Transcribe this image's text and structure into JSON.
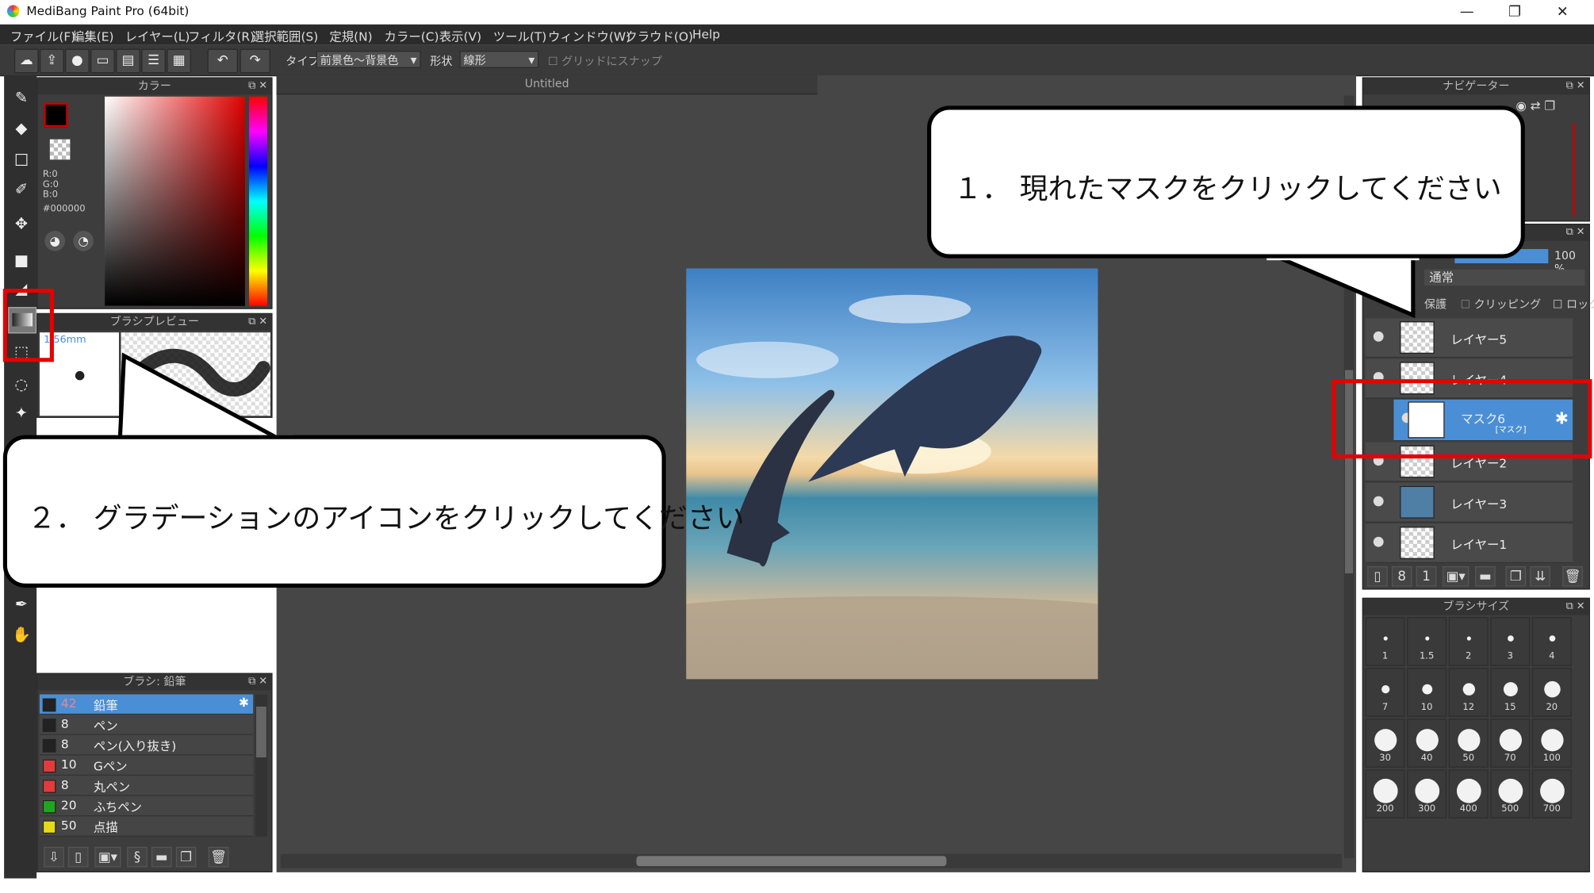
{
  "window": {
    "title": "MediBang Paint Pro (64bit)",
    "minimize": "—",
    "restore": "❐",
    "close": "✕"
  },
  "menu": [
    "ファイル(F)",
    "編集(E)",
    "レイヤー(L)",
    "フィルタ(R)",
    "選択範囲(S)",
    "定規(N)",
    "カラー(C)",
    "表示(V)",
    "ツール(T)",
    "ウィンドウ(W)",
    "クラウド(O)",
    "Help"
  ],
  "toolbar": {
    "type_label": "タイプ",
    "type_value": "前景色〜背景色",
    "shape_label": "形状",
    "shape_value": "線形",
    "grid_snap": "グリッドにスナップ"
  },
  "color_panel": {
    "title": "カラー",
    "r": "R:0",
    "g": "G:0",
    "b": "B:0",
    "hex": "#000000"
  },
  "brush_preview": {
    "title": "ブラシプレビュー",
    "size": "1.56mm"
  },
  "brush_panel": {
    "title": "ブラシ: 鉛筆",
    "items": [
      {
        "size": "42",
        "name": "鉛筆",
        "color": "#222222"
      },
      {
        "size": "8",
        "name": "ペン",
        "color": "#222222"
      },
      {
        "size": "8",
        "name": "ペン(入り抜き)",
        "color": "#222222"
      },
      {
        "size": "10",
        "name": "Gペン",
        "color": "#e23b3b"
      },
      {
        "size": "8",
        "name": "丸ペン",
        "color": "#e23b3b"
      },
      {
        "size": "20",
        "name": "ふちペン",
        "color": "#1fa51f"
      },
      {
        "size": "50",
        "name": "点描",
        "color": "#e8d81a"
      }
    ]
  },
  "canvas": {
    "tab": "Untitled"
  },
  "navigator": {
    "title": "ナビゲーター"
  },
  "layers": {
    "opacity": "100 %",
    "blend": "通常",
    "protect": "保護",
    "clipping": "クリッピング",
    "lock": "ロック",
    "items": [
      {
        "name": "レイヤー5"
      },
      {
        "name": "レイヤー4"
      },
      {
        "name": "マスク6",
        "tag": "[マスク]"
      },
      {
        "name": "レイヤー2"
      },
      {
        "name": "レイヤー3"
      },
      {
        "name": "レイヤー1"
      }
    ]
  },
  "brush_size": {
    "title": "ブラシサイズ",
    "sizes": [
      "1",
      "1.5",
      "2",
      "3",
      "4",
      "7",
      "10",
      "12",
      "15",
      "20",
      "30",
      "40",
      "50",
      "70",
      "100",
      "200",
      "300",
      "400",
      "500",
      "700"
    ]
  },
  "callouts": {
    "one": "１． 現れたマスクをクリックしてください",
    "two": "２． グラデーションのアイコンをクリックしてください"
  },
  "colors": {
    "highlight": "#e60000",
    "selection": "#4a8fd6"
  }
}
